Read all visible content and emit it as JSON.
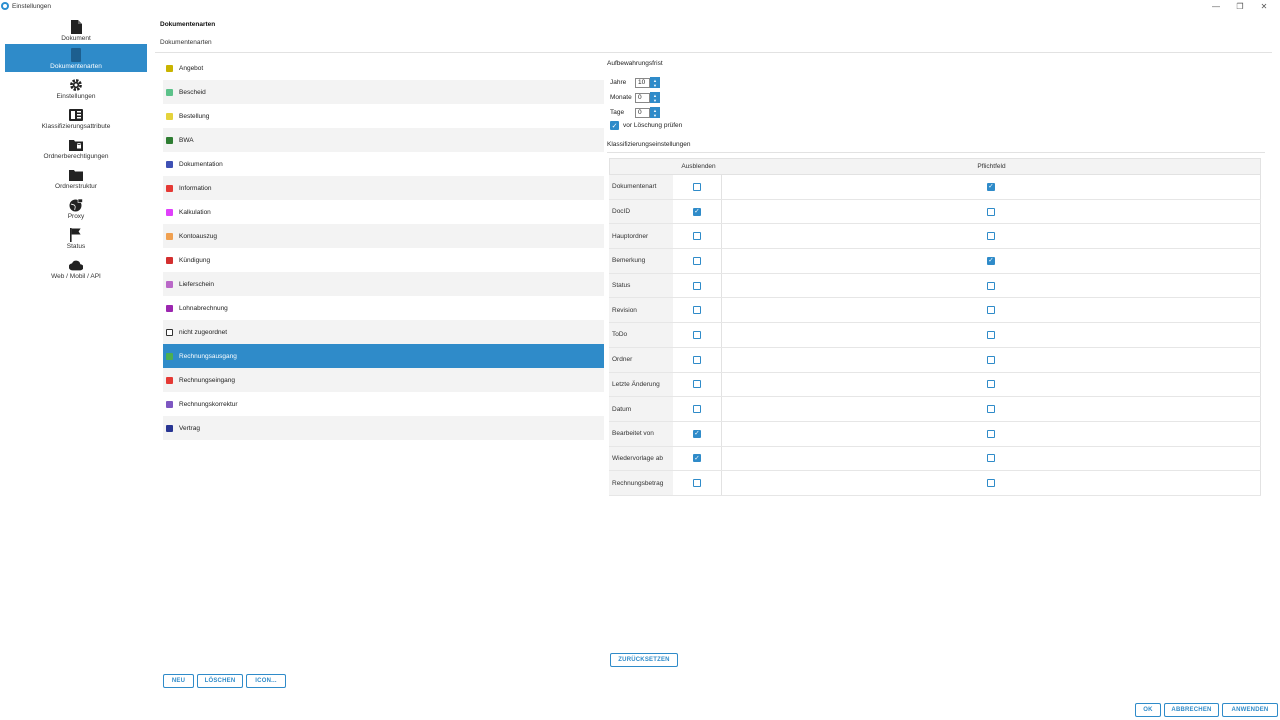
{
  "window": {
    "title": "Einstellungen",
    "controls": {
      "minimize": "—",
      "maximize": "❐",
      "close": "✕"
    }
  },
  "sidebar": {
    "items": [
      {
        "label": "Dokument",
        "icon": "document-icon",
        "active": false
      },
      {
        "label": "Dokumentenarten",
        "icon": "bookmark-icon",
        "active": true
      },
      {
        "label": "Einstellungen",
        "icon": "gear-icon",
        "active": false
      },
      {
        "label": "Klassifizierungsattribute",
        "icon": "list-icon",
        "active": false
      },
      {
        "label": "Ordnerberechtigungen",
        "icon": "folder-lock-icon",
        "active": false
      },
      {
        "label": "Ordnerstruktur",
        "icon": "folder-icon",
        "active": false
      },
      {
        "label": "Proxy",
        "icon": "globe-lock-icon",
        "active": false
      },
      {
        "label": "Status",
        "icon": "flag-icon",
        "active": false
      },
      {
        "label": "Web / Mobil / API",
        "icon": "cloud-icon",
        "active": false
      }
    ]
  },
  "header": {
    "title": "Dokumentenarten",
    "subtitle": "Dokumentenarten"
  },
  "doc_types": [
    {
      "label": "Angebot",
      "icon_color": "#c9b400"
    },
    {
      "label": "Bescheid",
      "icon_color": "#5cc28a"
    },
    {
      "label": "Bestellung",
      "icon_color": "#e5d33c"
    },
    {
      "label": "BWA",
      "icon_color": "#2e7d32"
    },
    {
      "label": "Dokumentation",
      "icon_color": "#3f51b5"
    },
    {
      "label": "Information",
      "icon_color": "#e53935"
    },
    {
      "label": "Kalkulation",
      "icon_color": "#e040fb"
    },
    {
      "label": "Kontoauszug",
      "icon_color": "#f0a050"
    },
    {
      "label": "Kündigung",
      "icon_color": "#d32f2f"
    },
    {
      "label": "Lieferschein",
      "icon_color": "#ba68c8"
    },
    {
      "label": "Lohnabrechnung",
      "icon_color": "#9c27b0"
    },
    {
      "label": "nicht zugeordnet",
      "icon_color": "#ffffff"
    },
    {
      "label": "Rechnungsausgang",
      "icon_color": "#4caf50"
    },
    {
      "label": "Rechnungseingang",
      "icon_color": "#e53935"
    },
    {
      "label": "Rechnungskorrektur",
      "icon_color": "#7e57c2"
    },
    {
      "label": "Vertrag",
      "icon_color": "#283593"
    }
  ],
  "selected_doc_index": 12,
  "retention": {
    "title": "Aufbewahrungsfrist",
    "years_label": "Jahre",
    "years_value": "10",
    "months_label": "Monate",
    "months_value": "0",
    "days_label": "Tage",
    "days_value": "0",
    "check_label": "vor Löschung prüfen",
    "check_value": true
  },
  "classification": {
    "title": "Klassifizierungseinstellungen",
    "col_hide": "Ausblenden",
    "col_required": "Pflichtfeld",
    "rows": [
      {
        "label": "Dokumentenart",
        "hide": false,
        "required": true
      },
      {
        "label": "DocID",
        "hide": true,
        "required": false
      },
      {
        "label": "Hauptordner",
        "hide": false,
        "required": false
      },
      {
        "label": "Bemerkung",
        "hide": false,
        "required": true
      },
      {
        "label": "Status",
        "hide": false,
        "required": false
      },
      {
        "label": "Revision",
        "hide": false,
        "required": false
      },
      {
        "label": "ToDo",
        "hide": false,
        "required": false
      },
      {
        "label": "Ordner",
        "hide": false,
        "required": false
      },
      {
        "label": "Letzte Änderung",
        "hide": false,
        "required": false
      },
      {
        "label": "Datum",
        "hide": false,
        "required": false
      },
      {
        "label": "Bearbeitet von",
        "hide": true,
        "required": false
      },
      {
        "label": "Wiedervorlage ab",
        "hide": true,
        "required": false
      },
      {
        "label": "Rechnungsbetrag",
        "hide": false,
        "required": false
      }
    ]
  },
  "buttons": {
    "reset": "ZURÜCKSETZEN",
    "new": "NEU",
    "delete": "LÖSCHEN",
    "icon": "ICON...",
    "ok": "OK",
    "cancel": "ABBRECHEN",
    "apply": "ANWENDEN"
  },
  "colors": {
    "accent": "#2f8bc9"
  }
}
